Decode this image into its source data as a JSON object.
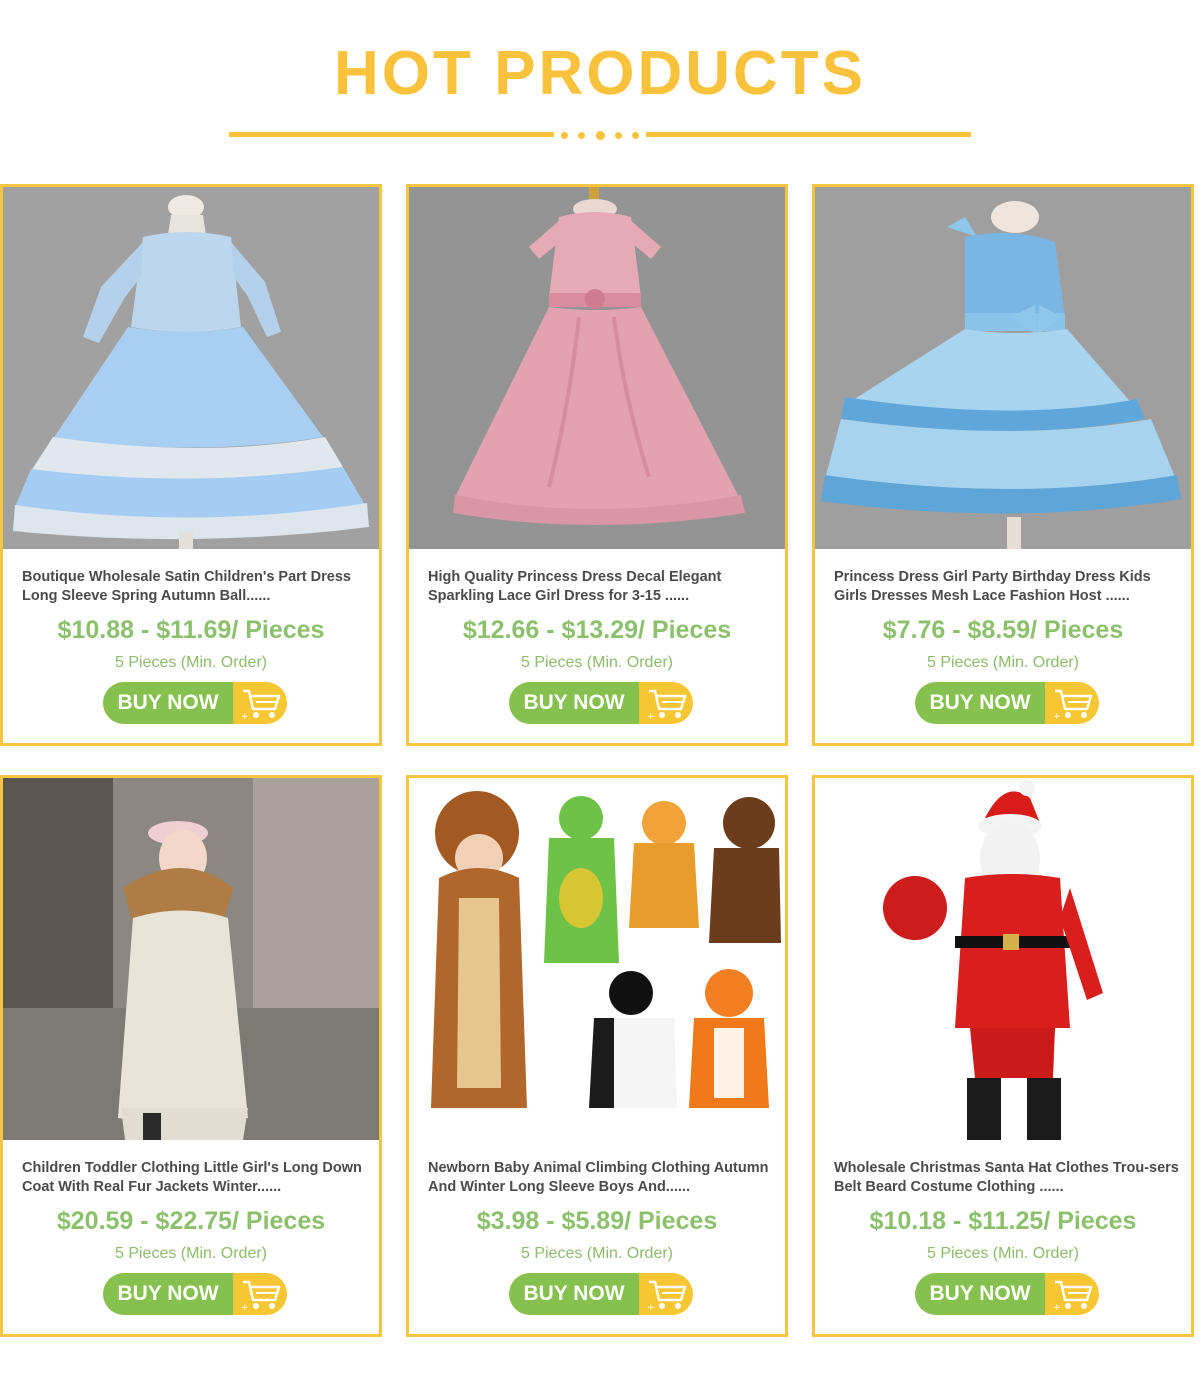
{
  "header": {
    "title": "HOT PRODUCTS"
  },
  "colors": {
    "accent": "#f8c23c",
    "price_green": "#8dc06d",
    "moq_green": "#8dbb6b",
    "buy_green": "#86c04e",
    "cart_yellow": "#f6c633",
    "card_border": "#f6c642"
  },
  "products": [
    {
      "name": "Boutique Wholesale Satin Children's Part Dress Long Sleeve Spring Autumn Ball......",
      "price": "$10.88 - $11.69/ Pieces",
      "moq": "5 Pieces (Min. Order)",
      "buy_label": "BUY NOW",
      "image": "blue-long-sleeve-ball-gown-dress"
    },
    {
      "name": "High Quality Princess Dress Decal Elegant Sparkling Lace Girl Dress for 3-15 ......",
      "price": "$12.66 - $13.29/ Pieces",
      "moq": "5 Pieces (Min. Order)",
      "buy_label": "BUY NOW",
      "image": "pink-lace-princess-gown"
    },
    {
      "name": "Princess Dress Girl Party Birthday Dress Kids Girls Dresses Mesh Lace Fashion Host ......",
      "price": "$7.76 - $8.59/ Pieces",
      "moq": "5 Pieces (Min. Order)",
      "buy_label": "BUY NOW",
      "image": "blue-sequin-bow-tutu-dress"
    },
    {
      "name": "Children Toddler Clothing Little Girl's Long Down Coat With Real Fur Jackets Winter......",
      "price": "$20.59 - $22.75/ Pieces",
      "moq": "5 Pieces (Min. Order)",
      "buy_label": "BUY NOW",
      "image": "girl-in-white-fur-hood-down-coat"
    },
    {
      "name": "Newborn Baby Animal Climbing Clothing Autumn And Winter Long Sleeve Boys And......",
      "price": "$3.98 - $5.89/ Pieces",
      "moq": "5 Pieces (Min. Order)",
      "buy_label": "BUY NOW",
      "image": "baby-animal-onesies"
    },
    {
      "name": "Wholesale Christmas Santa Hat Clothes Trou-sers Belt Beard Costume Clothing ......",
      "price": "$10.18 - $11.25/ Pieces",
      "moq": "5 Pieces (Min. Order)",
      "buy_label": "BUY NOW",
      "image": "kids-santa-claus-costume"
    }
  ]
}
